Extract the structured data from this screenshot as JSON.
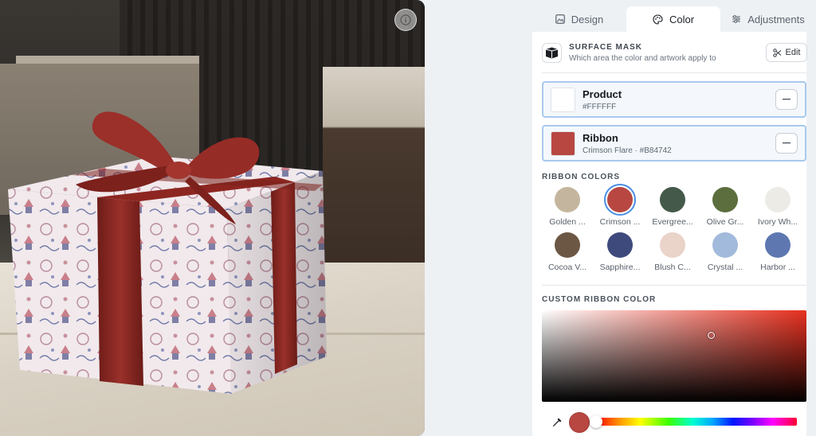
{
  "tabs": [
    {
      "label": "Design",
      "icon": "image-icon"
    },
    {
      "label": "Color",
      "icon": "palette-icon"
    },
    {
      "label": "Adjustments",
      "icon": "sliders-icon"
    }
  ],
  "surface_mask": {
    "title": "SURFACE MASK",
    "subtitle": "Which area the color and artwork apply to",
    "edit_label": "Edit"
  },
  "regions": [
    {
      "name": "Product",
      "value": "#FFFFFF",
      "color": "#FFFFFF"
    },
    {
      "name": "Ribbon",
      "value": "Crimson Flare · #B84742",
      "color": "#B84742"
    }
  ],
  "ribbon_colors": {
    "title": "RIBBON COLORS",
    "selected_index": 1,
    "items": [
      {
        "label": "Golden ...",
        "color": "#C4B69E"
      },
      {
        "label": "Crimson ...",
        "color": "#B84742"
      },
      {
        "label": "Evergree...",
        "color": "#44594A"
      },
      {
        "label": "Olive Gr...",
        "color": "#5C6E3E"
      },
      {
        "label": "Ivory Wh...",
        "color": "#EDEBE6"
      },
      {
        "label": "Cocoa V...",
        "color": "#6B5743"
      },
      {
        "label": "Sapphire...",
        "color": "#3E4A7C"
      },
      {
        "label": "Blush C...",
        "color": "#EAD3C9"
      },
      {
        "label": "Crystal ...",
        "color": "#A2BADB"
      },
      {
        "label": "Harbor ...",
        "color": "#5E77B0"
      }
    ]
  },
  "custom_color": {
    "title": "CUSTOM RIBBON COLOR",
    "current": "#B84742"
  },
  "colors": {
    "accent": "#4A8EE6",
    "region_border": "#A9C9EE",
    "ribbon": "#8E2A24"
  }
}
